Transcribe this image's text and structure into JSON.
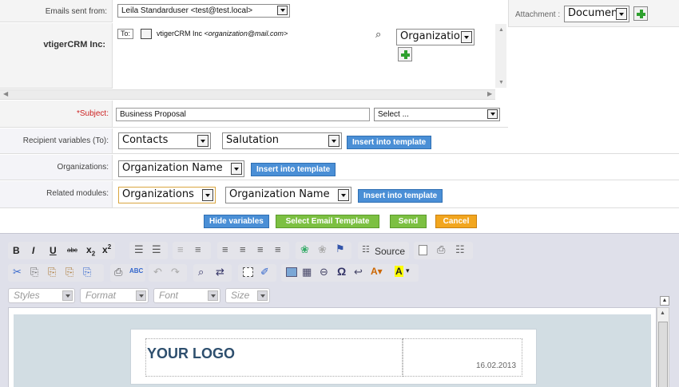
{
  "form": {
    "emails_sent_from_label": "Emails sent from:",
    "emails_sent_from_value": "Leila Standarduser <test@test.local>",
    "company_label": "vtigerCRM Inc:",
    "to_prefix": "To:",
    "to_name": "vtigerCRM Inc",
    "to_email": "<organization@mail.com>",
    "to_module": "Organizations",
    "attachment_label": "Attachment :",
    "attachment_value": "Document",
    "subject_label": "*Subject:",
    "subject_value": "Business Proposal",
    "subject_select": "Select ...",
    "recipient_vars_label": "Recipient variables (To):",
    "recipient_module": "Contacts",
    "recipient_field": "Salutation",
    "organizations_label": "Organizations:",
    "org_field": "Organization Name",
    "related_modules_label": "Related modules:",
    "related_module": "Organizations",
    "related_field": "Organization Name",
    "insert_label": "Insert into template"
  },
  "actions": {
    "hide_variables": "Hide variables",
    "select_template": "Select Email Template",
    "send": "Send",
    "cancel": "Cancel"
  },
  "editor": {
    "source_label": "Source",
    "styles": "Styles",
    "format": "Format",
    "font": "Font",
    "size": "Size",
    "logo_text": "YOUR LOGO",
    "date_text": "16.02.2013"
  },
  "colors": {
    "insert_blue": "#4a8fd6",
    "send_green": "#7cc042",
    "cancel_orange": "#f2a61f",
    "toolbar_bg": "#dfe0ea"
  }
}
